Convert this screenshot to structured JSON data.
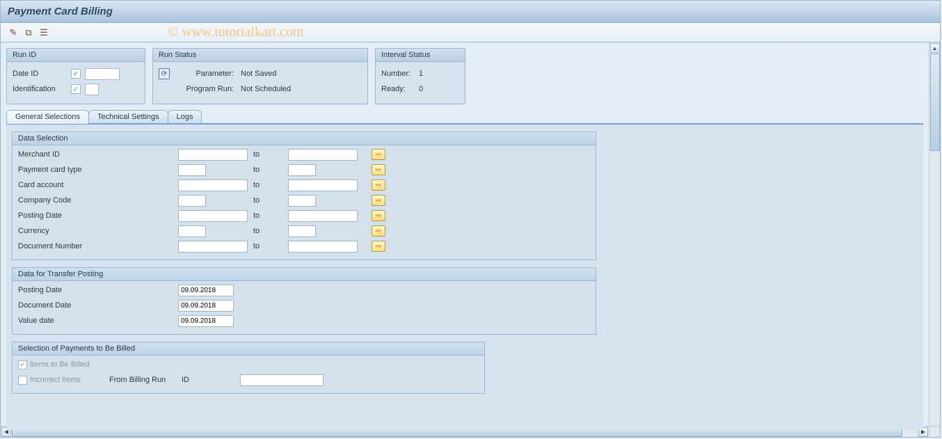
{
  "header": {
    "title": "Payment Card Billing"
  },
  "watermark": "© www.tutorialkart.com",
  "toolbar": {
    "icons": [
      "pencil-icon",
      "copy-icon",
      "settings-icon"
    ]
  },
  "boxes": {
    "run_id": {
      "title": "Run ID",
      "date_id_label": "Date ID",
      "identification_label": "Identification"
    },
    "run_status": {
      "title": "Run Status",
      "parameter_label": "Parameter:",
      "parameter_value": "Not Saved",
      "program_label": "Program Run:",
      "program_value": "Not Scheduled"
    },
    "interval_status": {
      "title": "Interval Status",
      "number_label": "Number:",
      "number_value": "1",
      "ready_label": "Ready:",
      "ready_value": "0"
    }
  },
  "tabs": {
    "general": "General Selections",
    "technical": "Technical Settings",
    "logs": "Logs"
  },
  "data_selection": {
    "title": "Data Selection",
    "to_label": "to",
    "rows": [
      {
        "label": "Merchant ID",
        "w": "full"
      },
      {
        "label": "Payment card type",
        "w": "sm"
      },
      {
        "label": "Card account",
        "w": "full"
      },
      {
        "label": "Company Code",
        "w": "sm"
      },
      {
        "label": "Posting Date",
        "w": "full"
      },
      {
        "label": "Currency",
        "w": "sm"
      },
      {
        "label": "Document Number",
        "w": "full"
      }
    ]
  },
  "transfer": {
    "title": "Data for Transfer Posting",
    "posting_date_label": "Posting Date",
    "posting_date_value": "09.09.2018",
    "document_date_label": "Document Date",
    "document_date_value": "09.09.2018",
    "value_date_label": "Value date",
    "value_date_value": "09.09.2018"
  },
  "sop": {
    "title": "Selection of Payments to Be Billed",
    "items_label": "Items to Be Billed",
    "incorrect_label": "Incorrect Items",
    "from_label": "From Billing Run",
    "id_label": "ID"
  }
}
